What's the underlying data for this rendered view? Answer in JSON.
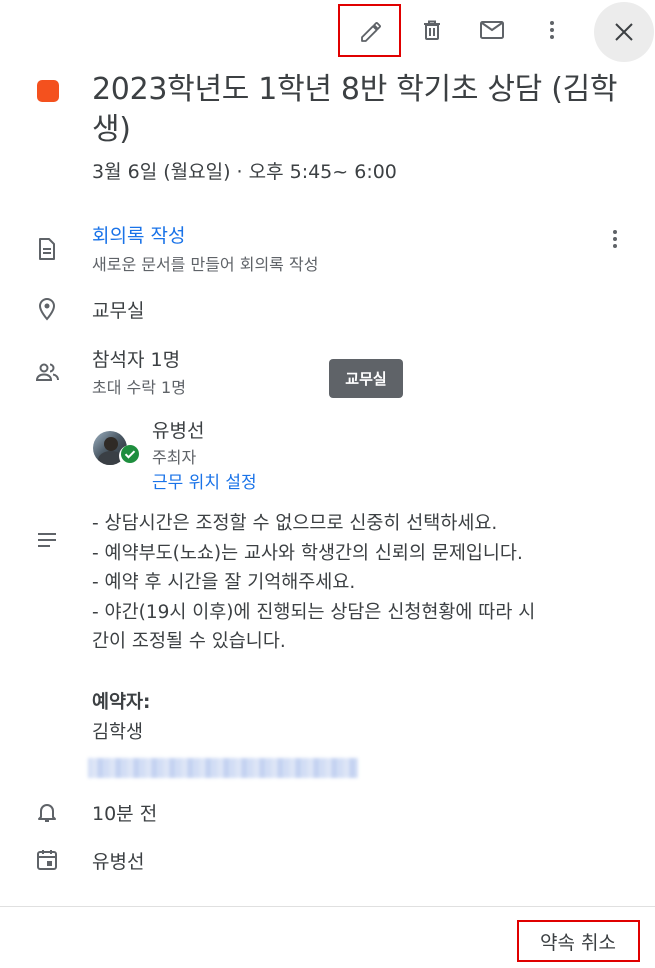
{
  "toolbar": {
    "edit_icon": "pencil-icon",
    "delete_icon": "trash-icon",
    "email_icon": "mail-icon",
    "more_icon": "more-vert-icon",
    "close_icon": "close-icon"
  },
  "event": {
    "color": "#f4511e",
    "title": "2023학년도 1학년 8반 학기초 상담 (김학생)",
    "datetime": "3월 6일 (월요일)  ·  오후 5:45~ 6:00"
  },
  "notes": {
    "link": "회의록 작성",
    "sub": "새로운 문서를 만들어 회의록 작성"
  },
  "location": "교무실",
  "guests": {
    "summary": "참석자 1명",
    "sub": "초대 수락 1명",
    "tooltip": "교무실",
    "person": {
      "name": "유병선",
      "role": "주최자",
      "link": "근무 위치 설정"
    }
  },
  "description": {
    "lines": [
      "- 상담시간은 조정할 수 없으므로 신중히 선택하세요.",
      "- 예약부도(노쇼)는 교사와 학생간의 신뢰의 문제입니다.",
      "- 예약 후 시간을 잘 기억해주세요.",
      "- 야간(19시 이후)에 진행되는 상담은 신청현황에 따라 시",
      "간이 조정될 수 있습니다."
    ],
    "booker_label": "예약자:",
    "booker_name": "김학생"
  },
  "reminder": "10분 전",
  "calendar_owner": "유병선",
  "footer": {
    "cancel_label": "약속 취소"
  },
  "colors": {
    "accent": "#1a73e8",
    "highlight": "#e00000",
    "event": "#f4511e"
  }
}
